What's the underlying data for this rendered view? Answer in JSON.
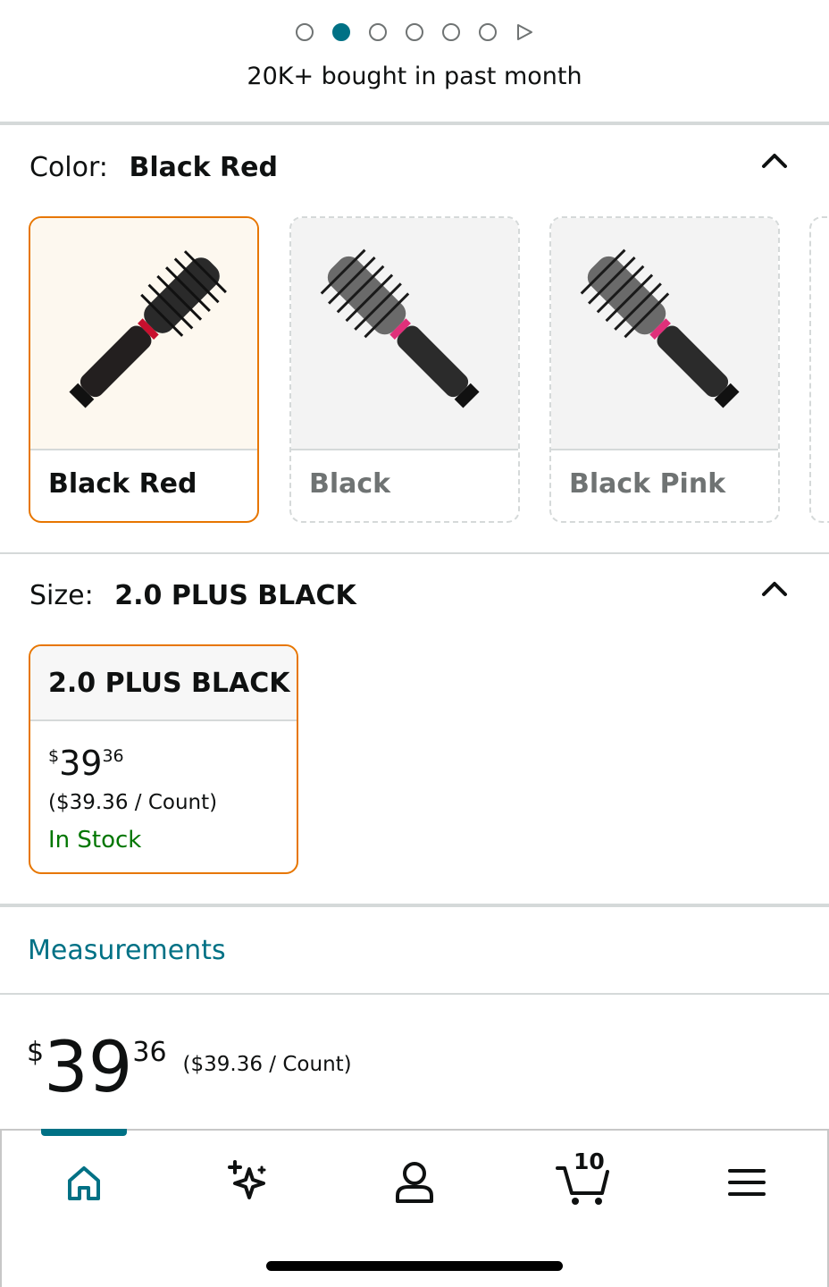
{
  "carousel": {
    "total_dots": 6,
    "active_index": 1
  },
  "social_proof": "20K+ bought in past month",
  "color": {
    "label": "Color:",
    "selected": "Black Red",
    "options": [
      {
        "name": "Black Red",
        "accent": "#c8102e"
      },
      {
        "name": "Black",
        "accent": "#e0307a"
      },
      {
        "name": "Black Pink",
        "accent": "#e0307a"
      }
    ]
  },
  "size": {
    "label": "Size:",
    "selected": "2.0 PLUS BLACK",
    "option": {
      "name": "2.0 PLUS BLACK",
      "currency": "$",
      "whole": "39",
      "fraction": "36",
      "per_unit": "($39.36 / Count)",
      "availability": "In Stock"
    }
  },
  "measurements_link": "Measurements",
  "price": {
    "currency": "$",
    "whole": "39",
    "fraction": "36",
    "per_unit": "($39.36 / Count)"
  },
  "bottom_nav": {
    "items": [
      "home-icon",
      "sparkle-icon",
      "account-icon",
      "cart-icon",
      "menu-icon"
    ],
    "cart_count": "10"
  },
  "colors": {
    "accent_teal": "#007185",
    "selected_border": "#e77600",
    "in_stock": "#007600"
  }
}
